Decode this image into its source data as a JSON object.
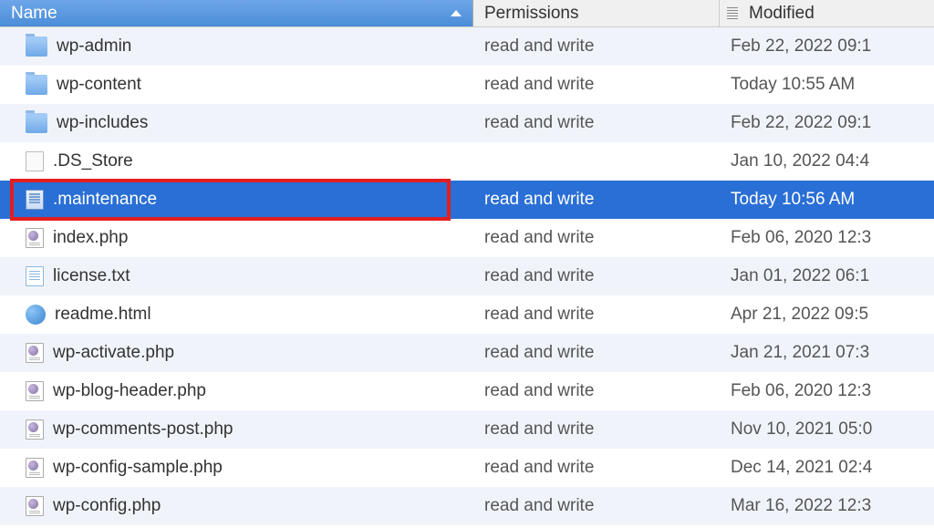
{
  "columns": {
    "name": "Name",
    "permissions": "Permissions",
    "modified": "Modified"
  },
  "files": [
    {
      "name": "wp-admin",
      "permissions": "read and write",
      "modified": "Feb 22, 2022 09:1",
      "icon": "folder"
    },
    {
      "name": "wp-content",
      "permissions": "read and write",
      "modified": "Today 10:55 AM",
      "icon": "folder"
    },
    {
      "name": "wp-includes",
      "permissions": "read and write",
      "modified": "Feb 22, 2022 09:1",
      "icon": "folder"
    },
    {
      "name": ".DS_Store",
      "permissions": "",
      "modified": "Jan 10, 2022 04:4",
      "icon": "plain"
    },
    {
      "name": ".maintenance",
      "permissions": "read and write",
      "modified": "Today 10:56 AM",
      "icon": "selected-file"
    },
    {
      "name": "index.php",
      "permissions": "read and write",
      "modified": "Feb 06, 2020 12:3",
      "icon": "php"
    },
    {
      "name": "license.txt",
      "permissions": "read and write",
      "modified": "Jan 01, 2022 06:1",
      "icon": "txt"
    },
    {
      "name": "readme.html",
      "permissions": "read and write",
      "modified": "Apr 21, 2022 09:5",
      "icon": "html"
    },
    {
      "name": "wp-activate.php",
      "permissions": "read and write",
      "modified": "Jan 21, 2021 07:3",
      "icon": "php"
    },
    {
      "name": "wp-blog-header.php",
      "permissions": "read and write",
      "modified": "Feb 06, 2020 12:3",
      "icon": "php"
    },
    {
      "name": "wp-comments-post.php",
      "permissions": "read and write",
      "modified": "Nov 10, 2021 05:0",
      "icon": "php"
    },
    {
      "name": "wp-config-sample.php",
      "permissions": "read and write",
      "modified": "Dec 14, 2021 02:4",
      "icon": "php"
    },
    {
      "name": "wp-config.php",
      "permissions": "read and write",
      "modified": "Mar 16, 2022 12:3",
      "icon": "php"
    }
  ],
  "selected_index": 4,
  "highlighted_index": 4
}
